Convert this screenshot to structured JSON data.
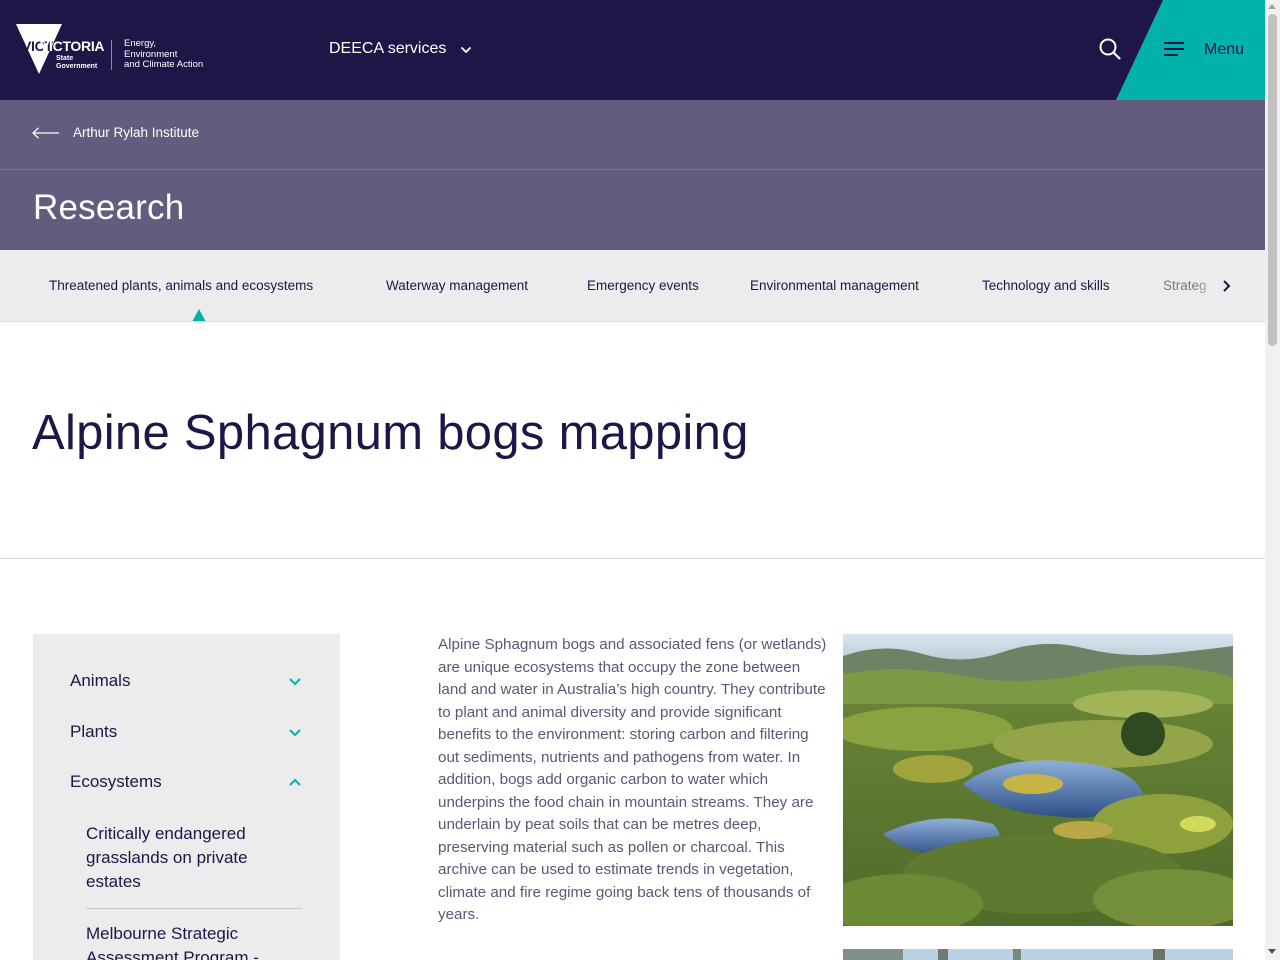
{
  "header": {
    "logo_word": "VICTORIA",
    "logo_sub_1": "State",
    "logo_sub_2": "Government",
    "dept_line_1": "Energy,",
    "dept_line_2": "Environment",
    "dept_line_3": "and Climate Action",
    "services_label": "DEECA services",
    "menu_label": "Menu",
    "icons": {
      "search": "search-icon",
      "menu": "hamburger-icon",
      "services": "chevron-down-icon"
    },
    "colors": {
      "navy": "#201547",
      "teal": "#00b2a9"
    }
  },
  "band": {
    "back_label": "Arthur Rylah Institute",
    "title": "Research",
    "color": "#635c7e"
  },
  "tabs": {
    "items": [
      {
        "label": "Threatened plants, animals and ecosystems",
        "active": true
      },
      {
        "label": "Waterway management"
      },
      {
        "label": "Emergency events"
      },
      {
        "label": "Environmental management"
      },
      {
        "label": "Technology and skills"
      },
      {
        "label": "Strateg"
      }
    ]
  },
  "page": {
    "title": "Alpine Sphagnum bogs mapping"
  },
  "sidenav": {
    "items": [
      {
        "label": "Animals",
        "state": "collapsed"
      },
      {
        "label": "Plants",
        "state": "collapsed"
      },
      {
        "label": "Ecosystems",
        "state": "expanded"
      }
    ],
    "sub_items": [
      {
        "label": "Critically endangered grasslands on private estates"
      },
      {
        "label": "Melbourne Strategic Assessment Program -"
      }
    ]
  },
  "content": {
    "intro": "Alpine Sphagnum bogs and associated fens (or wetlands) are unique ecosystems that occupy the zone between land and water in Australia’s high country. They contribute to plant and animal diversity and provide significant benefits to the environment: storing carbon and filtering out sediments, nutrients and pathogens from water. In addition, bogs add organic carbon to water which underpins the food chain in mountain streams. They are underlain by peat soils that can be metres deep, preserving material such as pollen or charcoal. This archive can be used to estimate trends in vegetation, climate and fire regime going back tens of thousands of years."
  }
}
